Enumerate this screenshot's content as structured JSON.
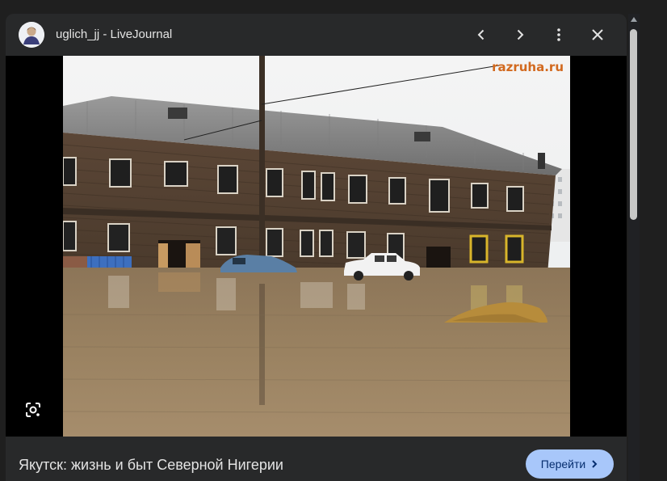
{
  "header": {
    "source_title": "uglich_jj - LiveJournal",
    "prev_icon": "chevron-left-icon",
    "next_icon": "chevron-right-icon",
    "more_icon": "more-vert-icon",
    "close_icon": "close-icon"
  },
  "image": {
    "watermark": "razruha.ru",
    "lens_icon": "lens-search-icon"
  },
  "footer": {
    "caption": "Якутск: жизнь и быт Северной Нигерии",
    "visit_label": "Перейти",
    "visit_icon": "chevron-right-icon"
  },
  "colors": {
    "panel_bg": "#28292a",
    "page_bg": "#1f1f1f",
    "button_bg": "#a8c7fa",
    "button_text": "#062e6f",
    "text": "#e3e3e3"
  }
}
